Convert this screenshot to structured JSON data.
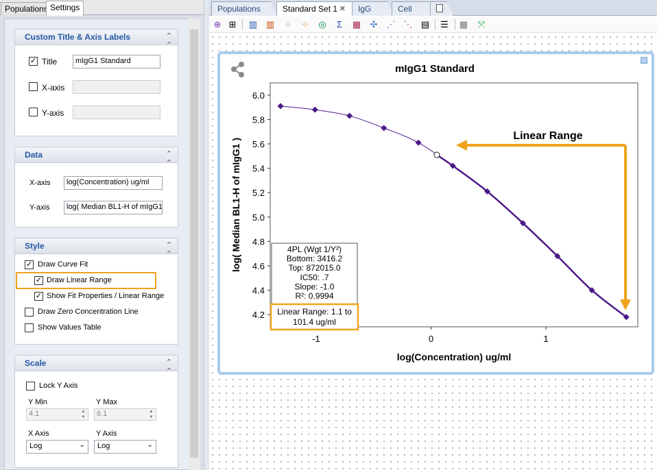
{
  "left_tabs": [
    "Populations",
    "Settings"
  ],
  "sections": {
    "custom": {
      "title": "Custom Title & Axis Labels",
      "title_label": "Title",
      "title_value": "mIgG1 Standard",
      "title_checked": "✓",
      "xaxis_label": "X-axis",
      "xaxis_value": "",
      "yaxis_label": "Y-axis",
      "yaxis_value": ""
    },
    "data": {
      "title": "Data",
      "xaxis_label": "X-axis",
      "xaxis_value": "log(Concentration) ug/ml",
      "yaxis_label": "Y-axis",
      "yaxis_value": "log( Median BL1-H of mIgG1"
    },
    "style": {
      "title": "Style",
      "draw_curve_fit": "Draw Curve Fit",
      "draw_linear_range": "Draw Linear Range",
      "show_fit_props": "Show Fit Properties / Linear Range",
      "draw_zero_line": "Draw Zero Concentration Line",
      "show_values_table": "Show Values Table",
      "check": "✓"
    },
    "scale": {
      "title": "Scale",
      "lock_y_axis": "Lock Y Axis",
      "y_min_label": "Y Min",
      "y_min_value": "4.1",
      "y_max_label": "Y Max",
      "y_max_value": "6.1",
      "x_axis_label": "X Axis",
      "x_axis_value": "Log",
      "y_axis_label": "Y Axis",
      "y_axis_value": "Log"
    }
  },
  "doc_tabs": [
    "Populations",
    "Standard Set 1",
    "IgG",
    "Cell"
  ],
  "close_glyph": "✕",
  "collapse_glyph": "⌃",
  "chart_data": {
    "type": "scatter",
    "title": "mIgG1 Standard",
    "xlabel": "log(Concentration) ug/ml",
    "ylabel": "log( Median BL1-H of mIgG1 )",
    "xlim": [
      -1.4,
      1.8
    ],
    "ylim": [
      4.1,
      6.1
    ],
    "xticks": [
      "-1",
      "0",
      "1"
    ],
    "xtick_values": [
      -1,
      0,
      1
    ],
    "yticks": [
      "4.2",
      "4.4",
      "4.6",
      "4.8",
      "5.0",
      "5.2",
      "5.4",
      "5.6",
      "5.8",
      "6.0"
    ],
    "ytick_values": [
      4.2,
      4.4,
      4.6,
      4.8,
      5.0,
      5.2,
      5.4,
      5.6,
      5.8,
      6.0
    ],
    "points": [
      {
        "x": -1.31,
        "y": 5.91
      },
      {
        "x": -1.01,
        "y": 5.88
      },
      {
        "x": -0.71,
        "y": 5.83
      },
      {
        "x": -0.41,
        "y": 5.73
      },
      {
        "x": -0.11,
        "y": 5.61
      },
      {
        "x": 0.19,
        "y": 5.42
      },
      {
        "x": 0.49,
        "y": 5.21
      },
      {
        "x": 0.8,
        "y": 4.95
      },
      {
        "x": 1.1,
        "y": 4.68
      },
      {
        "x": 1.4,
        "y": 4.4
      },
      {
        "x": 1.7,
        "y": 4.18
      }
    ],
    "linear_range_start": {
      "x": 0.05,
      "y": 5.51
    },
    "fit_box": [
      "4PL (Wgt 1/Y²)",
      "Bottom: 3416.2",
      "Top: 872015.0",
      "IC50: .7",
      "Slope: -1.0",
      "R²: 0.9994"
    ],
    "linear_range_box": [
      "Linear Range: 1.1 to",
      "101.4 ug/ml"
    ],
    "annotation": "Linear Range",
    "accent_color": "#f0a31e",
    "curve_color": "#4b1a87"
  }
}
